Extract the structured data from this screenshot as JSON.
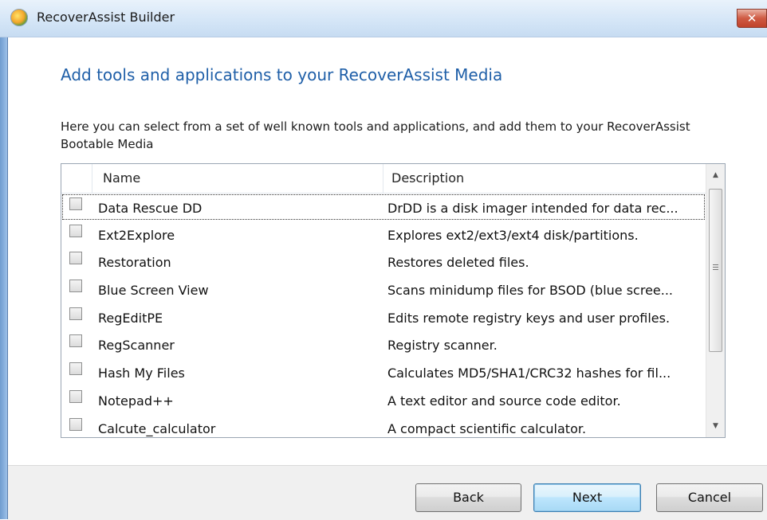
{
  "window": {
    "title": "RecoverAssist Builder",
    "close_label": "✕"
  },
  "page": {
    "heading": "Add tools and applications to your RecoverAssist Media",
    "intro": "Here you can select from a set of well known tools and applications, and add them to your RecoverAssist Bootable Media"
  },
  "list": {
    "columns": {
      "name": "Name",
      "description": "Description"
    },
    "rows": [
      {
        "name": "Data Rescue DD",
        "description": "DrDD is a disk imager intended for data rec...",
        "checked": false
      },
      {
        "name": "Ext2Explore",
        "description": "Explores ext2/ext3/ext4 disk/partitions.",
        "checked": false
      },
      {
        "name": "Restoration",
        "description": "Restores deleted files.",
        "checked": false
      },
      {
        "name": "Blue Screen View",
        "description": "Scans minidump files for BSOD (blue scree...",
        "checked": false
      },
      {
        "name": "RegEditPE",
        "description": "Edits remote registry keys and user profiles.",
        "checked": false
      },
      {
        "name": "RegScanner",
        "description": "Registry scanner.",
        "checked": false
      },
      {
        "name": "Hash My Files",
        "description": "Calculates MD5/SHA1/CRC32 hashes for fil...",
        "checked": false
      },
      {
        "name": "Notepad++",
        "description": "A text editor and source code editor.",
        "checked": false
      },
      {
        "name": "Calcute_calculator",
        "description": "A compact scientific calculator.",
        "checked": false
      }
    ],
    "scrollbar": {
      "up_icon": "▲",
      "down_icon": "▼"
    }
  },
  "buttons": {
    "back": "Back",
    "next": "Next",
    "cancel": "Cancel"
  },
  "colors": {
    "heading": "#1f5fa8",
    "titlebar": "#d5e6f7",
    "close": "#c7432b"
  }
}
